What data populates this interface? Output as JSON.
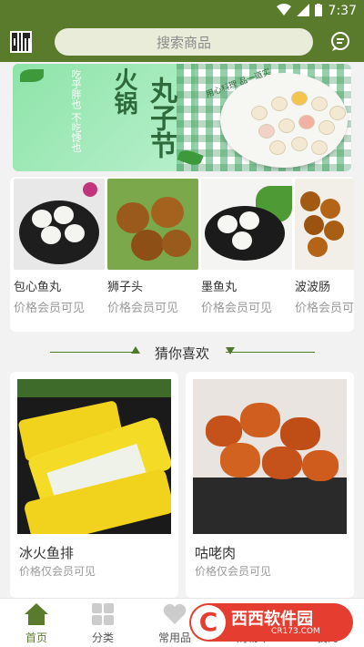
{
  "status": {
    "time": "7:37"
  },
  "header": {
    "search_placeholder": "搜索商品",
    "qr_icon": "qr-code-icon",
    "message_icon": "message-icon"
  },
  "banner": {
    "title_a": "火锅",
    "title_b": "丸子节",
    "tagline": "吃乎胖也 不吃馋也",
    "subtitle": "用心料理 品一道实"
  },
  "products": [
    {
      "name": "包心鱼丸",
      "price": "价格会员可见"
    },
    {
      "name": "狮子头",
      "price": "价格会员可见"
    },
    {
      "name": "墨鱼丸",
      "price": "价格会员可见"
    },
    {
      "name": "波波肠",
      "price": "价格会员可见"
    }
  ],
  "section": {
    "title": "猜你喜欢"
  },
  "recommend": [
    {
      "name": "冰火鱼排",
      "price": "价格仅会员可见"
    },
    {
      "name": "咕咾肉",
      "price": "价格仅会员可见"
    }
  ],
  "tabbar": [
    {
      "label": "首页",
      "icon": "home-icon",
      "active": true
    },
    {
      "label": "分类",
      "icon": "grid-icon",
      "active": false
    },
    {
      "label": "常用品",
      "icon": "heart-icon",
      "active": false
    },
    {
      "label": "购物车",
      "icon": "cart-icon",
      "active": false
    },
    {
      "label": "我的",
      "icon": "user-icon",
      "active": false
    }
  ],
  "watermark": {
    "logo": "C",
    "brand": "西西软件园",
    "url": "CR173.COM"
  },
  "colors": {
    "primary": "#5a7a2c",
    "search_bg": "#e9ecd8",
    "muted_text": "#9a9a9a"
  }
}
